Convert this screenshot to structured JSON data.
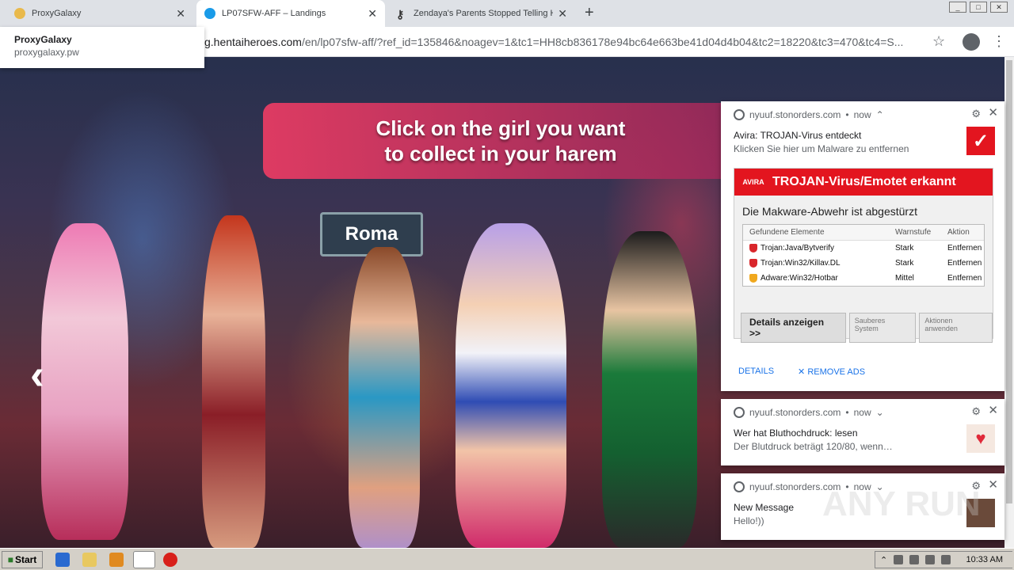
{
  "browser": {
    "tabs": [
      {
        "title": "ProxyGalaxy",
        "favicon_color": "#e9b94b"
      },
      {
        "title": "LP07SFW-AFF – Landings",
        "favicon_color": "#1a9be8"
      },
      {
        "title": "Zendaya's Parents Stopped Telling H",
        "favicon_color": "#333333"
      }
    ],
    "url_prefix": "g.hentaiheroes.com",
    "url_rest": "/en/lp07sfw-aff/?ref_id=135846&noagev=1&tc1=HH8cb836178e94bc64e663be41d04d4b04&tc2=18220&tc3=470&tc4=S...",
    "suggestion": {
      "title": "ProxyGalaxy",
      "url": "proxygalaxy.pw"
    }
  },
  "page": {
    "banner_line1": "Click on the girl you want",
    "banner_line2": "to collect in your harem",
    "sign": "Roma"
  },
  "notifications": [
    {
      "site": "nyuuf.stonorders.com",
      "time": "now",
      "title": "Avira: TROJAN-Virus entdeckt",
      "text": "Klicken Sie hier um Malware zu entfernen",
      "image": {
        "logo": "AVIRA",
        "header": "TROJAN-Virus/Emotet erkannt",
        "subtitle": "Die Makware-Abwehr ist abgestürzt",
        "columns": [
          "Gefundene Elemente",
          "Warnstufe",
          "Aktion"
        ],
        "rows": [
          {
            "name": "Trojan:Java/Bytverify",
            "level": "Stark",
            "action": "Entfernen",
            "color": "#d9262b"
          },
          {
            "name": "Trojan:Win32/Killav.DL",
            "level": "Stark",
            "action": "Entfernen",
            "color": "#d9262b"
          },
          {
            "name": "Adware:Win32/Hotbar",
            "level": "Mittel",
            "action": "Entfernen",
            "color": "#f0a81e"
          }
        ],
        "btn_details": "Details anzeigen >>",
        "btn_clean": "Sauberes System",
        "btn_apply": "Aktionen anwenden"
      },
      "action_details": "DETAILS",
      "action_remove": "REMOVE ADS"
    },
    {
      "site": "nyuuf.stonorders.com",
      "time": "now",
      "title": "Wer hat Bluthochdruck: lesen",
      "text": "Der Blutdruck beträgt 120/80, wenn…"
    },
    {
      "site": "nyuuf.stonorders.com",
      "time": "now",
      "title": "New Message",
      "text": "Hello!))"
    }
  ],
  "watermark": "ANY RUN",
  "taskbar": {
    "start": "Start",
    "clock": "10:33 AM"
  }
}
